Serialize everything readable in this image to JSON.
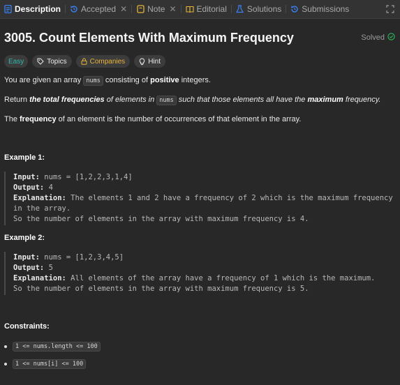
{
  "tabs": [
    {
      "label": "Description",
      "icon": "description-icon",
      "active": true
    },
    {
      "label": "Accepted",
      "icon": "history-icon",
      "closable": true
    },
    {
      "label": "Note",
      "icon": "note-icon",
      "closable": true
    },
    {
      "label": "Editorial",
      "icon": "book-icon"
    },
    {
      "label": "Solutions",
      "icon": "flask-icon"
    },
    {
      "label": "Submissions",
      "icon": "history-icon"
    }
  ],
  "problem": {
    "title": "3005. Count Elements With Maximum Frequency",
    "status": "Solved",
    "tags": {
      "difficulty": "Easy",
      "topics": "Topics",
      "companies": "Companies",
      "hint": "Hint"
    }
  },
  "description": {
    "p1": {
      "a": "You are given an array ",
      "code": "nums",
      "b": " consisting of ",
      "bold": "positive",
      "c": " integers."
    },
    "p2": {
      "a": "Return ",
      "b1": "the ",
      "b2": "total frequencies",
      "c": " of elements in ",
      "code": "nums",
      "d": " such that those elements all have the ",
      "e": "maximum",
      "f": " frequency."
    },
    "p3": {
      "a": "The ",
      "bold": "frequency",
      "b": " of an element is the number of occurrences of that element in the array."
    }
  },
  "examples": [
    {
      "heading": "Example 1:",
      "input_label": "Input:",
      "input": " nums = [1,2,2,3,1,4]",
      "output_label": "Output:",
      "output": " 4",
      "explanation_label": "Explanation:",
      "explanation_line1": " The elements 1 and 2 have a frequency of 2 which is the maximum frequency",
      "explanation_line2": "in the array.",
      "explanation_line3": "So the number of elements in the array with maximum frequency is 4."
    },
    {
      "heading": "Example 2:",
      "input_label": "Input:",
      "input": " nums = [1,2,3,4,5]",
      "output_label": "Output:",
      "output": " 5",
      "explanation_label": "Explanation:",
      "explanation_line1": " All elements of the array have a frequency of 1 which is the maximum.",
      "explanation_line2": "So the number of elements in the array with maximum frequency is 5."
    }
  ],
  "constraints": {
    "heading": "Constraints:",
    "items": [
      "1 <= nums.length <= 100",
      "1 <= nums[i] <= 100"
    ]
  },
  "colors": {
    "background": "#282828",
    "easy": "#2cbbb0",
    "companies": "#e8b33a",
    "solved": "#2cbb5d",
    "description_icon": "#3b82f6"
  }
}
